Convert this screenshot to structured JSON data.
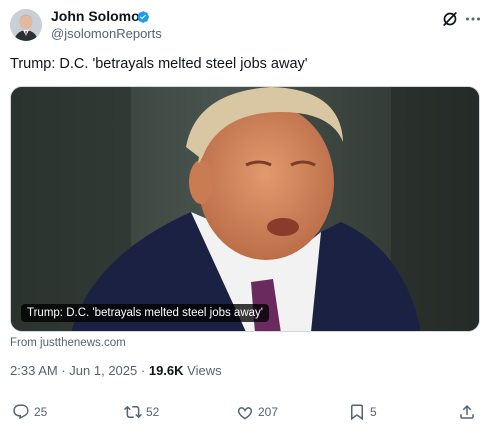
{
  "author": {
    "name": "John Solomon",
    "handle": "@jsolomonReports",
    "verified": true,
    "verified_color": "#1d9bf0"
  },
  "header_icons": [
    "grok-icon",
    "more-icon"
  ],
  "tweet": {
    "text": "Trump: D.C. 'betrayals melted steel jobs away'"
  },
  "media": {
    "caption": "Trump: D.C. 'betrayals melted steel jobs away'",
    "source": "From justthenews.com"
  },
  "meta": {
    "time": "2:33 AM",
    "separator": "·",
    "date": "Jun 1, 2025",
    "views_count": "19.6K",
    "views_label": "Views"
  },
  "actions": {
    "replies": "25",
    "reposts": "52",
    "likes": "207",
    "bookmarks": "5"
  },
  "colors": {
    "text_primary": "#0f1419",
    "text_secondary": "#536471",
    "border": "#cfd9de"
  }
}
